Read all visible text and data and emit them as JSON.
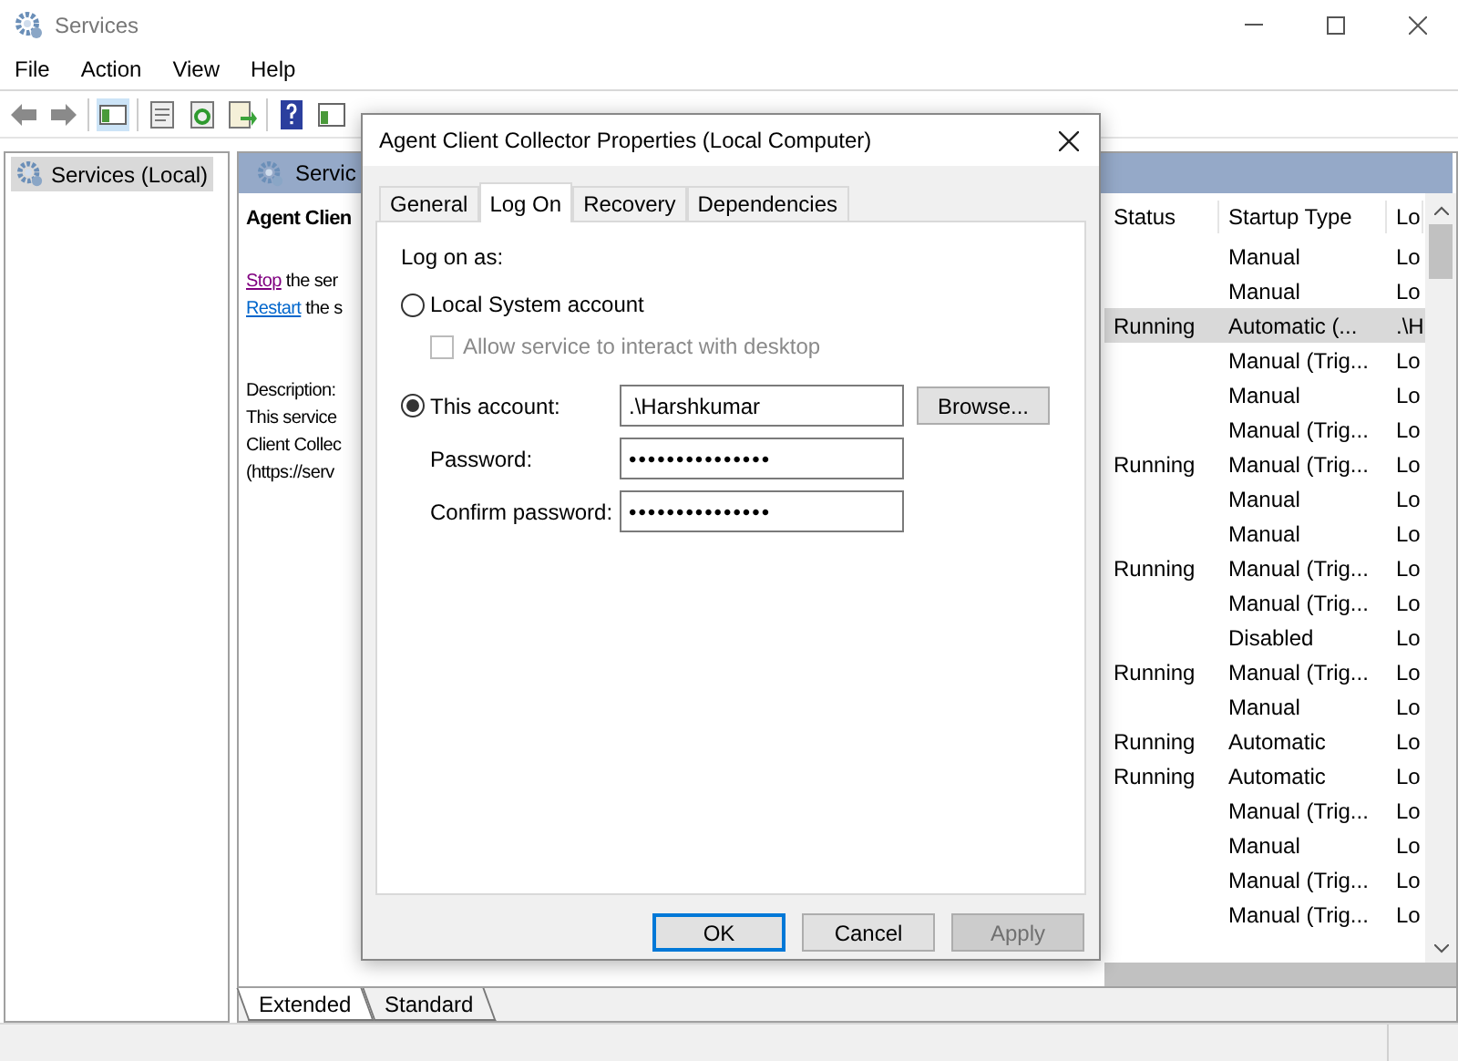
{
  "window": {
    "title": "Services"
  },
  "menu": [
    "File",
    "Action",
    "View",
    "Help"
  ],
  "tree": {
    "items": [
      {
        "label": "Services (Local)",
        "selected": true
      }
    ]
  },
  "detail": {
    "header": "Servic",
    "service_name": "Agent Clien",
    "actions": [
      {
        "link": "Stop",
        "rest": " the ser"
      },
      {
        "link": "Restart",
        "rest": " the s"
      }
    ],
    "description_label": "Description:",
    "description_lines": [
      "This service",
      "Client Collec",
      "(https://serv"
    ]
  },
  "table": {
    "columns": [
      "Status",
      "Startup Type",
      "Lo"
    ],
    "rows": [
      {
        "status": "",
        "startup_type": "Manual",
        "log_on": "Lo",
        "selected": false
      },
      {
        "status": "",
        "startup_type": "Manual",
        "log_on": "Lo",
        "selected": false
      },
      {
        "status": "Running",
        "startup_type": "Automatic (...",
        "log_on": ".\\H",
        "selected": true
      },
      {
        "status": "",
        "startup_type": "Manual (Trig...",
        "log_on": "Lo",
        "selected": false
      },
      {
        "status": "",
        "startup_type": "Manual",
        "log_on": "Lo",
        "selected": false
      },
      {
        "status": "",
        "startup_type": "Manual (Trig...",
        "log_on": "Lo",
        "selected": false
      },
      {
        "status": "Running",
        "startup_type": "Manual (Trig...",
        "log_on": "Lo",
        "selected": false
      },
      {
        "status": "",
        "startup_type": "Manual",
        "log_on": "Lo",
        "selected": false
      },
      {
        "status": "",
        "startup_type": "Manual",
        "log_on": "Lo",
        "selected": false
      },
      {
        "status": "Running",
        "startup_type": "Manual (Trig...",
        "log_on": "Lo",
        "selected": false
      },
      {
        "status": "",
        "startup_type": "Manual (Trig...",
        "log_on": "Lo",
        "selected": false
      },
      {
        "status": "",
        "startup_type": "Disabled",
        "log_on": "Lo",
        "selected": false
      },
      {
        "status": "Running",
        "startup_type": "Manual (Trig...",
        "log_on": "Lo",
        "selected": false
      },
      {
        "status": "",
        "startup_type": "Manual",
        "log_on": "Lo",
        "selected": false
      },
      {
        "status": "Running",
        "startup_type": "Automatic",
        "log_on": "Lo",
        "selected": false
      },
      {
        "status": "Running",
        "startup_type": "Automatic",
        "log_on": "Lo",
        "selected": false
      },
      {
        "status": "",
        "startup_type": "Manual (Trig...",
        "log_on": "Lo",
        "selected": false
      },
      {
        "status": "",
        "startup_type": "Manual",
        "log_on": "Lo",
        "selected": false
      },
      {
        "status": "",
        "startup_type": "Manual (Trig...",
        "log_on": "Lo",
        "selected": false
      },
      {
        "status": "",
        "startup_type": "Manual (Trig...",
        "log_on": "Lo",
        "selected": false
      }
    ]
  },
  "view_tabs": [
    {
      "label": "Extended",
      "selected": true
    },
    {
      "label": "Standard",
      "selected": false
    }
  ],
  "dialog": {
    "title": "Agent Client Collector Properties (Local Computer)",
    "tabs": [
      {
        "label": "General",
        "selected": false
      },
      {
        "label": "Log On",
        "selected": true
      },
      {
        "label": "Recovery",
        "selected": false
      },
      {
        "label": "Dependencies",
        "selected": false
      }
    ],
    "log_on_as": "Log on as:",
    "local_system": {
      "label": "Local System account",
      "selected": false
    },
    "interact": {
      "label": "Allow service to interact with desktop",
      "checked": false,
      "disabled": true
    },
    "this_account": {
      "label": "This account:",
      "selected": true,
      "value": ".\\Harshkumar"
    },
    "browse": "Browse...",
    "password": {
      "label": "Password:",
      "value": "•••••••••••••••"
    },
    "confirm": {
      "label": "Confirm password:",
      "value": "•••••••••••••••"
    },
    "buttons": [
      {
        "label": "OK",
        "kind": "default",
        "disabled": false
      },
      {
        "label": "Cancel",
        "kind": "normal",
        "disabled": false
      },
      {
        "label": "Apply",
        "kind": "normal",
        "disabled": true
      }
    ]
  }
}
